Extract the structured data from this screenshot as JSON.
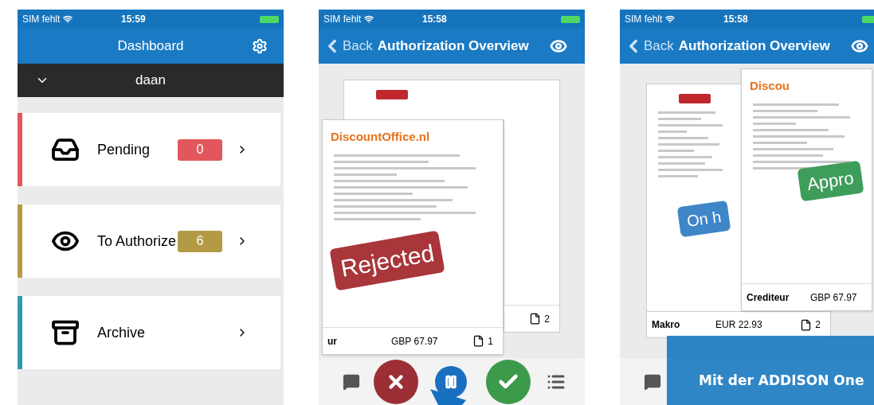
{
  "screens": [
    {
      "kind": "dashboard",
      "status_bar": {
        "carrier": "SIM fehlt",
        "time": "15:59"
      },
      "nav": {
        "title": "Dashboard"
      },
      "account": {
        "name": "daan"
      },
      "items": [
        {
          "label": "Pending",
          "count": "0",
          "color": "#e2575c"
        },
        {
          "label": "To Authorize",
          "count": "6",
          "color": "#b39a45"
        },
        {
          "label": "Archive",
          "color": "#2f9bb0"
        }
      ]
    },
    {
      "kind": "authorization",
      "status_bar": {
        "carrier": "SIM fehlt",
        "time": "15:58"
      },
      "nav": {
        "back": "Back",
        "title": "Authorization Overview"
      },
      "documents": [
        {
          "pages": "2"
        },
        {
          "logo": "DiscountOffice.nl",
          "stamp": {
            "text": "Rejected",
            "color": "#a8363b"
          },
          "supplier": "ur",
          "amount": "GBP 67.97",
          "pages": "1"
        }
      ]
    },
    {
      "kind": "authorization",
      "status_bar": {
        "carrier": "SIM fehlt",
        "time": "15:58"
      },
      "nav": {
        "back": "Back",
        "title": "Authorization Overview"
      },
      "documents": [
        {
          "stamp": {
            "text": "On h",
            "color": "#3f86c8"
          },
          "supplier": "Makro",
          "amount": "EUR 22.93",
          "pages": "2"
        },
        {
          "logo": "Discou",
          "stamp": {
            "text": "Appro",
            "color": "#3e9d5a"
          },
          "supplier": "Crediteur",
          "amount": "GBP 67.97"
        }
      ],
      "banner": {
        "text": "Mit der ADDISON One"
      }
    }
  ]
}
